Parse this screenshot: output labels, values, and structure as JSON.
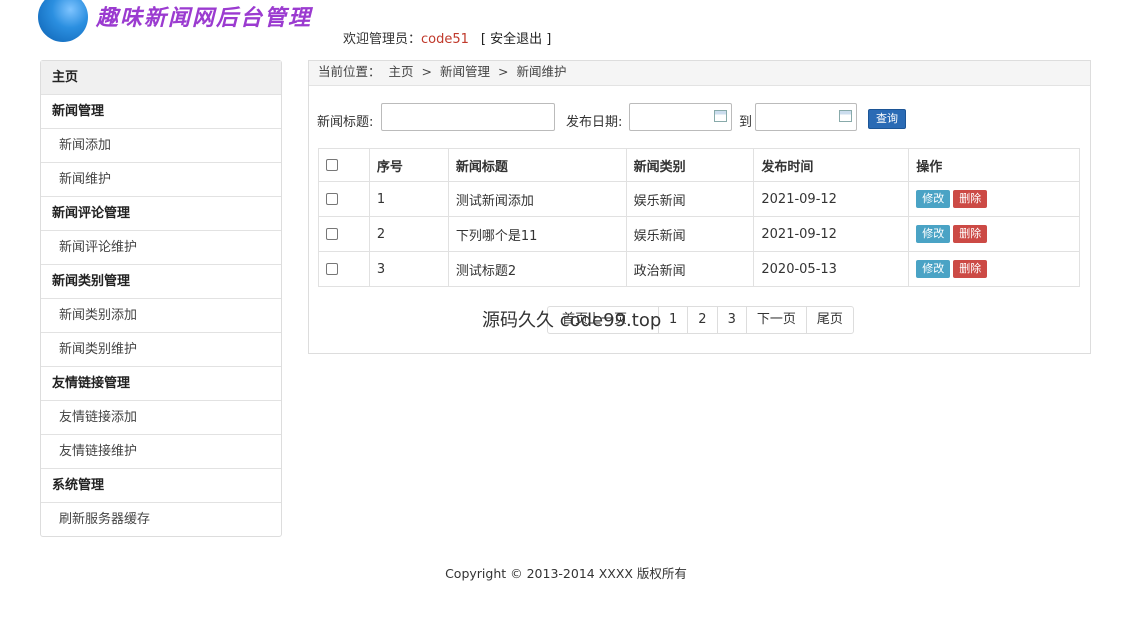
{
  "header": {
    "logo_text": "趣味新闻网后台管理",
    "welcome_label": "欢迎管理员：",
    "username": "code51",
    "logout": "[ 安全退出 ]"
  },
  "sidebar": {
    "home": "主页",
    "groups": [
      {
        "title": "新闻管理",
        "items": [
          "新闻添加",
          "新闻维护"
        ]
      },
      {
        "title": "新闻评论管理",
        "items": [
          "新闻评论维护"
        ]
      },
      {
        "title": "新闻类别管理",
        "items": [
          "新闻类别添加",
          "新闻类别维护"
        ]
      },
      {
        "title": "友情链接管理",
        "items": [
          "友情链接添加",
          "友情链接维护"
        ]
      },
      {
        "title": "系统管理",
        "items": [
          "刷新服务器缓存"
        ]
      }
    ]
  },
  "breadcrumb": {
    "prefix": "当前位置：",
    "items": [
      "主页",
      "新闻管理",
      "新闻维护"
    ],
    "separator": ">"
  },
  "search": {
    "title_label": "新闻标题:",
    "title_value": "",
    "date_label": "发布日期:",
    "date_from": "",
    "date_to_label": "到",
    "date_to": "",
    "query_button": "查询"
  },
  "table": {
    "headers": [
      "序号",
      "新闻标题",
      "新闻类别",
      "发布时间",
      "操作"
    ],
    "rows": [
      {
        "no": "1",
        "title": "测试新闻添加",
        "category": "娱乐新闻",
        "date": "2021-09-12"
      },
      {
        "no": "2",
        "title": "下列哪个是11",
        "category": "娱乐新闻",
        "date": "2021-09-12"
      },
      {
        "no": "3",
        "title": "测试标题2",
        "category": "政治新闻",
        "date": "2020-05-13"
      }
    ],
    "edit_label": "修改",
    "delete_label": "删除"
  },
  "pagination": {
    "first": "首页",
    "prev": "上一页",
    "pages": [
      "1",
      "2",
      "3"
    ],
    "next": "下一页",
    "last": "尾页"
  },
  "watermark": "源码久久 code99.top",
  "footer": "Copyright © 2013-2014 XXXX 版权所有",
  "colors": {
    "accent": "#2a6bb5",
    "edit": "#4aa3c5",
    "delete": "#cc4a45",
    "username": "#c0392b",
    "logo": "#9b3bd0"
  }
}
